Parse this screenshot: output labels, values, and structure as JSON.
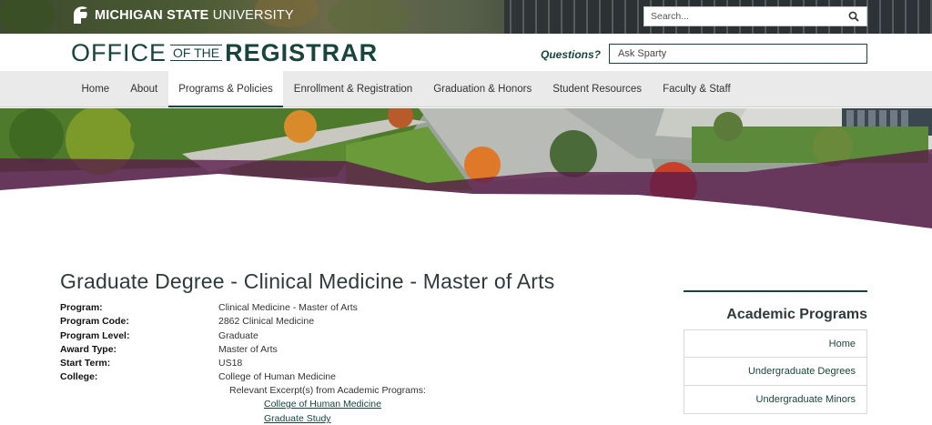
{
  "topbar": {
    "university": {
      "bold": "MICHIGAN STATE",
      "light": " UNIVERSITY"
    },
    "search_placeholder": "Search..."
  },
  "header": {
    "logo": {
      "office": "OFFICE",
      "ofthe": "OF THE",
      "registrar": "REGISTRAR"
    },
    "questions_label": "Questions?",
    "ask_placeholder": "Ask Sparty"
  },
  "nav": {
    "items": [
      {
        "label": "Home"
      },
      {
        "label": "About"
      },
      {
        "label": "Programs & Policies",
        "active": true
      },
      {
        "label": "Enrollment & Registration"
      },
      {
        "label": "Graduation & Honors"
      },
      {
        "label": "Student Resources"
      },
      {
        "label": "Faculty & Staff"
      }
    ]
  },
  "main": {
    "title": "Graduate Degree - Clinical Medicine - Master of Arts",
    "details": [
      {
        "label": "Program:",
        "value": "Clinical Medicine - Master of Arts"
      },
      {
        "label": "Program Code:",
        "value": "2862 Clinical Medicine"
      },
      {
        "label": "Program Level:",
        "value": "Graduate"
      },
      {
        "label": "Award Type:",
        "value": "Master of Arts"
      },
      {
        "label": "Start Term:",
        "value": "US18"
      },
      {
        "label": "College:",
        "value": "College of Human Medicine"
      }
    ],
    "excerpts_label": "Relevant Excerpt(s) from Academic Programs:",
    "excerpt_links": [
      "College of Human Medicine",
      "Graduate Study"
    ]
  },
  "sidebar": {
    "title": "Academic Programs",
    "items": [
      "Home",
      "Undergraduate Degrees",
      "Undergraduate Minors"
    ]
  },
  "colors": {
    "brand": "#18453b",
    "hero_overlay": "#5a1a4a"
  }
}
